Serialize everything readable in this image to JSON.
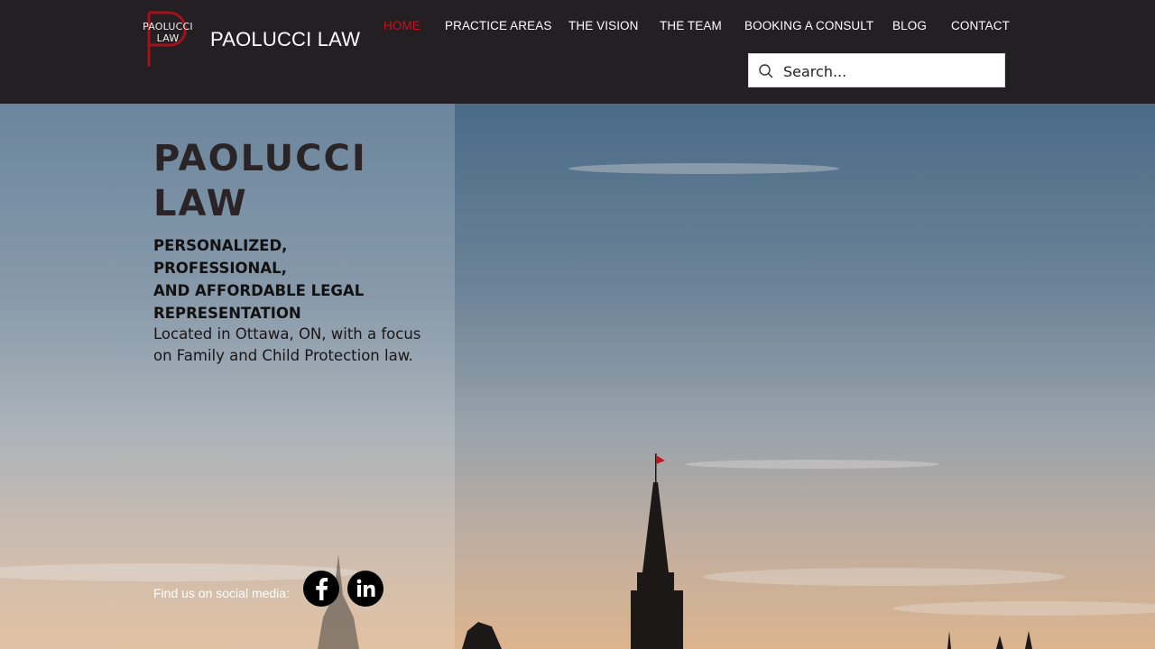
{
  "header": {
    "logo": {
      "line1": "PAOLUCCI",
      "line2": "LAW",
      "icon": "p-monogram-logo"
    },
    "brand": "PAOLUCCI LAW",
    "nav": [
      {
        "label": "HOME",
        "active": true
      },
      {
        "label": "PRACTICE AREAS",
        "active": false
      },
      {
        "label": "THE VISION",
        "active": false
      },
      {
        "label": "THE TEAM",
        "active": false
      },
      {
        "label": "BOOKING A CONSULT",
        "active": false
      },
      {
        "label": "BLOG",
        "active": false
      },
      {
        "label": "CONTACT",
        "active": false
      }
    ],
    "search": {
      "placeholder": "Search...",
      "icon": "search-icon"
    }
  },
  "hero": {
    "title_lines": [
      "PAOLUCCI",
      "LAW"
    ],
    "tagline_lines": [
      "PERSONALIZED, PROFESSIONAL,",
      "AND AFFORDABLE LEGAL",
      "REPRESENTATION"
    ],
    "description_lines": [
      "Located in Ottawa, ON, with a focus",
      "on Family and Child Protection law."
    ],
    "social_label": "Find us on social media:",
    "social": [
      {
        "icon": "facebook-icon",
        "glyph": "f"
      },
      {
        "icon": "linkedin-icon",
        "glyph": "in"
      }
    ]
  },
  "colors": {
    "header_bg": "#241f22",
    "active_nav": "#c4141c",
    "title": "#2a2427",
    "logo_accent": "#a3121b"
  }
}
